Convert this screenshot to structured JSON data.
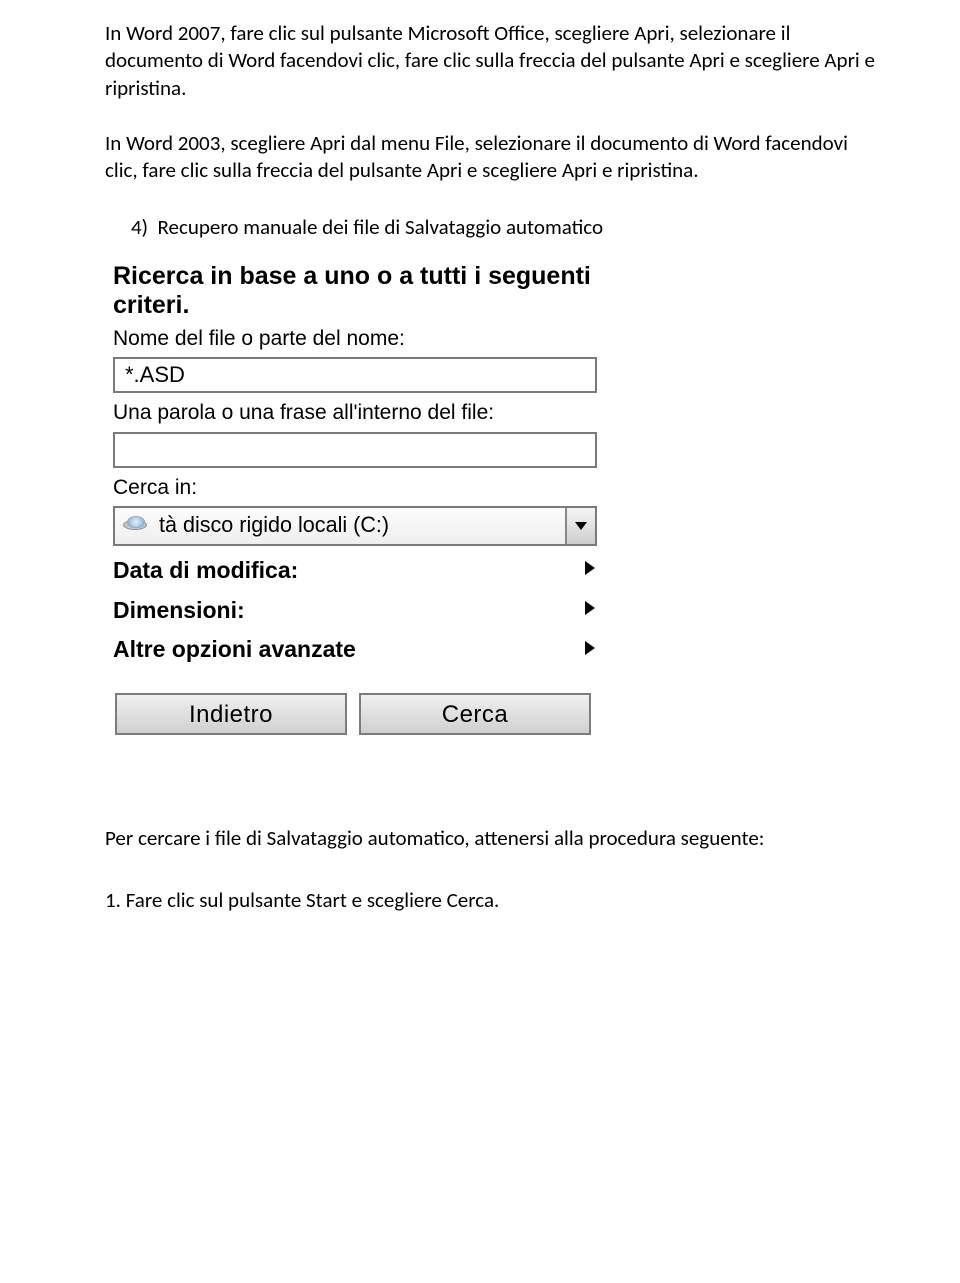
{
  "para1": "In Word 2007, fare clic sul pulsante Microsoft Office, scegliere Apri, selezionare il documento di Word facendovi clic, fare clic sulla freccia del pulsante Apri e scegliere Apri e ripristina.",
  "para2": "In Word 2003, scegliere Apri dal menu File, selezionare il documento di Word facendovi clic, fare clic sulla freccia del pulsante Apri e scegliere Apri e ripristina.",
  "section_heading": "4)  Recupero manuale dei file di Salvataggio automatico",
  "dialog": {
    "title": "Ricerca in base a uno o a tutti i seguenti criteri.",
    "filename_label": "Nome del file o parte del nome:",
    "filename_value": "*.ASD",
    "phrase_label": "Una parola o una frase all'interno del file:",
    "phrase_value": "",
    "lookin_label": "Cerca in:",
    "lookin_value": "tà disco rigido locali (C:)",
    "expand1": "Data di modifica:",
    "expand2": "Dimensioni:",
    "expand3": "Altre opzioni avanzate",
    "back_button": "Indietro",
    "search_button": "Cerca"
  },
  "para3": "Per cercare i file di Salvataggio automatico, attenersi alla procedura seguente:",
  "step1": "1. Fare clic sul pulsante Start e scegliere Cerca."
}
